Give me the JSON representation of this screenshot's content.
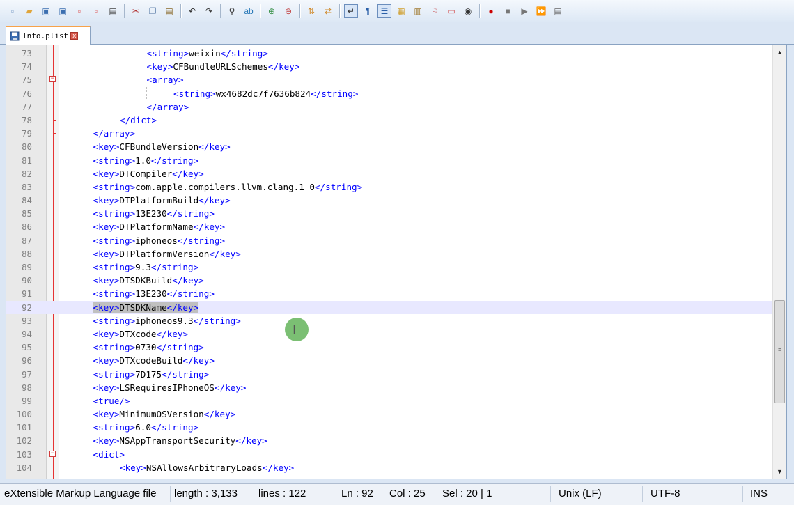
{
  "toolbar": {
    "buttons": [
      {
        "icon": "new-file-icon",
        "glyph": "▫",
        "color": "#7a9cc6"
      },
      {
        "icon": "open-file-icon",
        "glyph": "▰",
        "color": "#e0a53a"
      },
      {
        "icon": "save-icon",
        "glyph": "▣",
        "color": "#3c6fb0"
      },
      {
        "icon": "save-all-icon",
        "glyph": "▣",
        "color": "#3c6fb0"
      },
      {
        "icon": "close-file-icon",
        "glyph": "▫",
        "color": "#d55"
      },
      {
        "icon": "close-all-icon",
        "glyph": "▫",
        "color": "#d55"
      },
      {
        "icon": "print-icon",
        "glyph": "▤",
        "color": "#444"
      },
      {
        "sep": true
      },
      {
        "icon": "cut-icon",
        "glyph": "✂",
        "color": "#b03030"
      },
      {
        "icon": "copy-icon",
        "glyph": "❐",
        "color": "#4a6f9e"
      },
      {
        "icon": "paste-icon",
        "glyph": "▤",
        "color": "#8a6a2a"
      },
      {
        "sep": true
      },
      {
        "icon": "undo-icon",
        "glyph": "↶",
        "color": "#333"
      },
      {
        "icon": "redo-icon",
        "glyph": "↷",
        "color": "#333"
      },
      {
        "sep": true
      },
      {
        "icon": "find-icon",
        "glyph": "⚲",
        "color": "#333"
      },
      {
        "icon": "replace-icon",
        "glyph": "ab",
        "color": "#2a7ab8"
      },
      {
        "sep": true
      },
      {
        "icon": "zoom-in-icon",
        "glyph": "⊕",
        "color": "#2c8a3c"
      },
      {
        "icon": "zoom-out-icon",
        "glyph": "⊖",
        "color": "#c04040"
      },
      {
        "sep": true
      },
      {
        "icon": "sync-vertical-icon",
        "glyph": "⇅",
        "color": "#d08a2a"
      },
      {
        "icon": "sync-horizontal-icon",
        "glyph": "⇄",
        "color": "#d08a2a"
      },
      {
        "sep": true
      },
      {
        "icon": "word-wrap-icon",
        "glyph": "↵",
        "color": "#333",
        "active": true
      },
      {
        "icon": "show-all-characters-icon",
        "glyph": "¶",
        "color": "#2a5fa8"
      },
      {
        "icon": "indent-guide-icon",
        "glyph": "☰",
        "color": "#2a5fa8",
        "active": true
      },
      {
        "icon": "user-language-icon",
        "glyph": "▦",
        "color": "#d0a030"
      },
      {
        "icon": "function-list-icon",
        "glyph": "▥",
        "color": "#a07a30"
      },
      {
        "icon": "document-map-icon",
        "glyph": "⚐",
        "color": "#c03030"
      },
      {
        "icon": "folder-workspace-icon",
        "glyph": "▭",
        "color": "#d04040"
      },
      {
        "icon": "monitor-icon",
        "glyph": "◉",
        "color": "#333"
      },
      {
        "sep": true
      },
      {
        "icon": "record-macro-icon",
        "glyph": "●",
        "color": "#cc0000"
      },
      {
        "icon": "stop-record-icon",
        "glyph": "■",
        "color": "#777"
      },
      {
        "icon": "play-macro-icon",
        "glyph": "▶",
        "color": "#777"
      },
      {
        "icon": "play-multiple-icon",
        "glyph": "⏩",
        "color": "#3a5fb0"
      },
      {
        "icon": "save-macro-icon",
        "glyph": "▤",
        "color": "#666"
      }
    ]
  },
  "tab": {
    "filename": "Info.plist",
    "file_icon": "disk-icon",
    "close_icon": "close-icon",
    "close_glyph": "x"
  },
  "editor": {
    "current_line_number": 92,
    "lines": [
      {
        "n": "73",
        "indent": 3,
        "parts": [
          [
            "t",
            "<string>"
          ],
          [
            "c",
            "weixin"
          ],
          [
            "t",
            "</string>"
          ]
        ]
      },
      {
        "n": "74",
        "indent": 3,
        "parts": [
          [
            "t",
            "<key>"
          ],
          [
            "c",
            "CFBundleURLSchemes"
          ],
          [
            "t",
            "</key>"
          ]
        ]
      },
      {
        "n": "75",
        "indent": 3,
        "fold": "open",
        "parts": [
          [
            "t",
            "<array>"
          ]
        ]
      },
      {
        "n": "76",
        "indent": 4,
        "parts": [
          [
            "t",
            "<string>"
          ],
          [
            "c",
            "wx4682dc7f7636b824"
          ],
          [
            "t",
            "</string>"
          ]
        ]
      },
      {
        "n": "77",
        "indent": 3,
        "fold": "end",
        "parts": [
          [
            "t",
            "</array>"
          ]
        ]
      },
      {
        "n": "78",
        "indent": 2,
        "fold": "end",
        "parts": [
          [
            "t",
            "</dict>"
          ]
        ]
      },
      {
        "n": "79",
        "indent": 1,
        "fold": "end",
        "parts": [
          [
            "t",
            "</array>"
          ]
        ]
      },
      {
        "n": "80",
        "indent": 1,
        "parts": [
          [
            "t",
            "<key>"
          ],
          [
            "c",
            "CFBundleVersion"
          ],
          [
            "t",
            "</key>"
          ]
        ]
      },
      {
        "n": "81",
        "indent": 1,
        "parts": [
          [
            "t",
            "<string>"
          ],
          [
            "c",
            "1.0"
          ],
          [
            "t",
            "</string>"
          ]
        ]
      },
      {
        "n": "82",
        "indent": 1,
        "parts": [
          [
            "t",
            "<key>"
          ],
          [
            "c",
            "DTCompiler"
          ],
          [
            "t",
            "</key>"
          ]
        ]
      },
      {
        "n": "83",
        "indent": 1,
        "parts": [
          [
            "t",
            "<string>"
          ],
          [
            "c",
            "com.apple.compilers.llvm.clang.1_0"
          ],
          [
            "t",
            "</string>"
          ]
        ]
      },
      {
        "n": "84",
        "indent": 1,
        "parts": [
          [
            "t",
            "<key>"
          ],
          [
            "c",
            "DTPlatformBuild"
          ],
          [
            "t",
            "</key>"
          ]
        ]
      },
      {
        "n": "85",
        "indent": 1,
        "parts": [
          [
            "t",
            "<string>"
          ],
          [
            "c",
            "13E230"
          ],
          [
            "t",
            "</string>"
          ]
        ]
      },
      {
        "n": "86",
        "indent": 1,
        "parts": [
          [
            "t",
            "<key>"
          ],
          [
            "c",
            "DTPlatformName"
          ],
          [
            "t",
            "</key>"
          ]
        ]
      },
      {
        "n": "87",
        "indent": 1,
        "parts": [
          [
            "t",
            "<string>"
          ],
          [
            "c",
            "iphoneos"
          ],
          [
            "t",
            "</string>"
          ]
        ]
      },
      {
        "n": "88",
        "indent": 1,
        "parts": [
          [
            "t",
            "<key>"
          ],
          [
            "c",
            "DTPlatformVersion"
          ],
          [
            "t",
            "</key>"
          ]
        ]
      },
      {
        "n": "89",
        "indent": 1,
        "parts": [
          [
            "t",
            "<string>"
          ],
          [
            "c",
            "9.3"
          ],
          [
            "t",
            "</string>"
          ]
        ]
      },
      {
        "n": "90",
        "indent": 1,
        "parts": [
          [
            "t",
            "<key>"
          ],
          [
            "c",
            "DTSDKBuild"
          ],
          [
            "t",
            "</key>"
          ]
        ]
      },
      {
        "n": "91",
        "indent": 1,
        "parts": [
          [
            "t",
            "<string>"
          ],
          [
            "c",
            "13E230"
          ],
          [
            "t",
            "</string>"
          ]
        ]
      },
      {
        "n": "92",
        "indent": 1,
        "current": true,
        "selected": true,
        "parts": [
          [
            "t",
            "<key>"
          ],
          [
            "c",
            "DTSDKName"
          ],
          [
            "t",
            "</key>"
          ]
        ]
      },
      {
        "n": "93",
        "indent": 1,
        "parts": [
          [
            "t",
            "<string>"
          ],
          [
            "c",
            "iphoneos9.3"
          ],
          [
            "t",
            "</string>"
          ]
        ]
      },
      {
        "n": "94",
        "indent": 1,
        "parts": [
          [
            "t",
            "<key>"
          ],
          [
            "c",
            "DTXcode"
          ],
          [
            "t",
            "</key>"
          ]
        ]
      },
      {
        "n": "95",
        "indent": 1,
        "parts": [
          [
            "t",
            "<string>"
          ],
          [
            "c",
            "0730"
          ],
          [
            "t",
            "</string>"
          ]
        ]
      },
      {
        "n": "96",
        "indent": 1,
        "parts": [
          [
            "t",
            "<key>"
          ],
          [
            "c",
            "DTXcodeBuild"
          ],
          [
            "t",
            "</key>"
          ]
        ]
      },
      {
        "n": "97",
        "indent": 1,
        "parts": [
          [
            "t",
            "<string>"
          ],
          [
            "c",
            "7D175"
          ],
          [
            "t",
            "</string>"
          ]
        ]
      },
      {
        "n": "98",
        "indent": 1,
        "parts": [
          [
            "t",
            "<key>"
          ],
          [
            "c",
            "LSRequiresIPhoneOS"
          ],
          [
            "t",
            "</key>"
          ]
        ]
      },
      {
        "n": "99",
        "indent": 1,
        "parts": [
          [
            "t",
            "<true/>"
          ]
        ]
      },
      {
        "n": "100",
        "indent": 1,
        "parts": [
          [
            "t",
            "<key>"
          ],
          [
            "c",
            "MinimumOSVersion"
          ],
          [
            "t",
            "</key>"
          ]
        ]
      },
      {
        "n": "101",
        "indent": 1,
        "parts": [
          [
            "t",
            "<string>"
          ],
          [
            "c",
            "6.0"
          ],
          [
            "t",
            "</string>"
          ]
        ]
      },
      {
        "n": "102",
        "indent": 1,
        "parts": [
          [
            "t",
            "<key>"
          ],
          [
            "c",
            "NSAppTransportSecurity"
          ],
          [
            "t",
            "</key>"
          ]
        ]
      },
      {
        "n": "103",
        "indent": 1,
        "fold": "open",
        "parts": [
          [
            "t",
            "<dict>"
          ]
        ]
      },
      {
        "n": "104",
        "indent": 2,
        "parts": [
          [
            "t",
            "<key>"
          ],
          [
            "c",
            "NSAllowsArbitraryLoads"
          ],
          [
            "t",
            "</key>"
          ]
        ]
      }
    ]
  },
  "scrollbar": {
    "up_glyph": "▲",
    "down_glyph": "▼",
    "grip_glyph": "≡"
  },
  "statusbar": {
    "language": "eXtensible Markup Language file",
    "length": "length : 3,133",
    "lines": "lines : 122",
    "ln": "Ln : 92",
    "col": "Col : 25",
    "sel": "Sel : 20 | 1",
    "eol": "Unix (LF)",
    "encoding": "UTF-8",
    "mode": "INS"
  }
}
